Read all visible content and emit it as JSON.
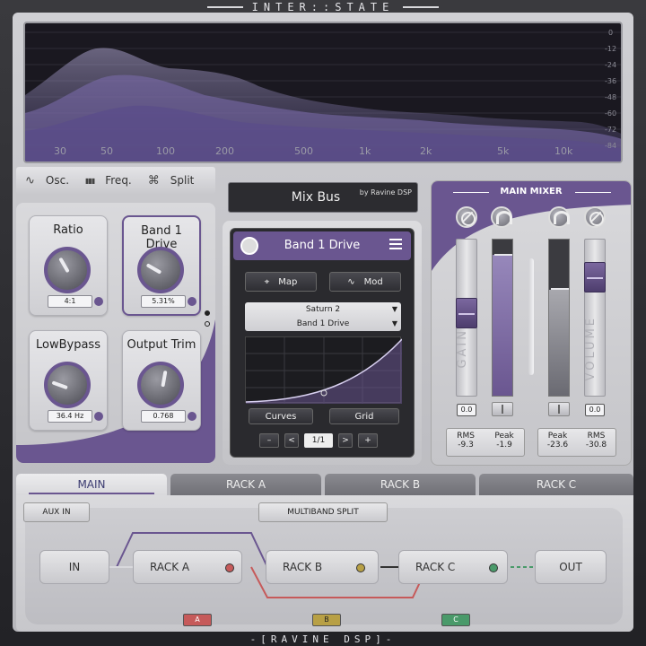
{
  "app": {
    "title": "INTER::STATE",
    "footer": "-[RAVINE DSP]-"
  },
  "spectrum": {
    "db_labels": [
      "0",
      "-12",
      "-24",
      "-36",
      "-48",
      "-60",
      "-72",
      "-84"
    ],
    "freq_labels": [
      "30",
      "50",
      "100",
      "200",
      "500",
      "1k",
      "2k",
      "5k",
      "10k"
    ]
  },
  "view_bar": {
    "items": [
      {
        "icon": "wave-icon",
        "glyph": "∿",
        "label": "Osc."
      },
      {
        "icon": "bars-icon",
        "glyph": "▮▮▮",
        "label": "Freq."
      },
      {
        "icon": "split-icon",
        "glyph": "⌘",
        "label": "Split"
      }
    ]
  },
  "knobs": [
    {
      "label": "Ratio",
      "value": "4:1",
      "angle": -30
    },
    {
      "label": "Band 1 Drive",
      "value": "5.31%",
      "angle": -60
    },
    {
      "label": "LowBypass",
      "value": "36.4 Hz",
      "angle": -70
    },
    {
      "label": "Output Trim",
      "value": "0.768",
      "angle": 10
    }
  ],
  "preset": {
    "name": "Mix Bus",
    "by": "by Ravine DSP"
  },
  "device": {
    "title": "Band 1 Drive",
    "map_label": "Map",
    "mod_label": "Mod",
    "select_line1": "Saturn 2",
    "select_line2": "Band 1 Drive",
    "curves_label": "Curves",
    "grid_label": "Grid",
    "minus": "–",
    "prev": "<",
    "page": "1/1",
    "next": ">",
    "plus": "+"
  },
  "mixer": {
    "title": "MAIN MIXER",
    "gain_label": "GAIN",
    "volume_label": "VOLUME",
    "gain_value": "0.0",
    "volume_value": "0.0",
    "in_stats": {
      "rms_label": "RMS",
      "rms": "-9.3",
      "peak_label": "Peak",
      "peak": "-1.9"
    },
    "out_stats": {
      "peak_label": "Peak",
      "peak": "-23.6",
      "rms_label": "RMS",
      "rms": "-30.8"
    }
  },
  "routing": {
    "tabs": [
      "MAIN",
      "RACK A",
      "RACK B",
      "RACK C"
    ],
    "aux_in": "AUX IN",
    "multiband": "MULTIBAND SPLIT",
    "nodes": {
      "in": "IN",
      "rack_a": "RACK A",
      "rack_b": "RACK B",
      "rack_c": "RACK C",
      "out": "OUT"
    },
    "tags": [
      "A",
      "B",
      "C"
    ],
    "colors": {
      "a": "#c65a5a",
      "b": "#b8a045",
      "c": "#4a9a6a",
      "accent": "#6a5690"
    }
  }
}
